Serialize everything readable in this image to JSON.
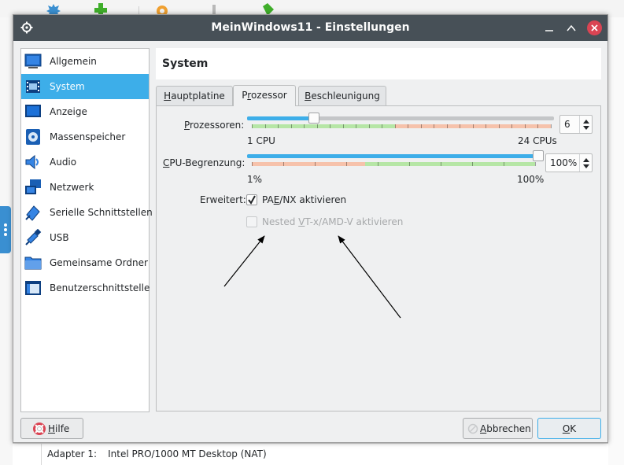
{
  "background": {
    "adapter_label": "Adapter 1:",
    "adapter_value": "Intel PRO/1000 MT Desktop (NAT)"
  },
  "dialog": {
    "title": "MeinWindows11 - Einstellungen"
  },
  "sidebar": {
    "items": [
      {
        "label": "Allgemein",
        "icon": "general-icon"
      },
      {
        "label": "System",
        "icon": "system-chip-icon",
        "selected": true
      },
      {
        "label": "Anzeige",
        "icon": "display-monitor-icon"
      },
      {
        "label": "Massenspeicher",
        "icon": "storage-disk-icon"
      },
      {
        "label": "Audio",
        "icon": "audio-speaker-icon"
      },
      {
        "label": "Netzwerk",
        "icon": "network-icon"
      },
      {
        "label": "Serielle Schnittstellen",
        "icon": "serial-port-icon"
      },
      {
        "label": "USB",
        "icon": "usb-icon"
      },
      {
        "label": "Gemeinsame Ordner",
        "icon": "shared-folder-icon"
      },
      {
        "label": "Benutzerschnittstelle",
        "icon": "user-interface-icon"
      }
    ]
  },
  "main": {
    "header_title": "System",
    "tabs": {
      "hauptplatine": {
        "pre": "",
        "key": "H",
        "post": "auptplatine"
      },
      "prozessor": {
        "pre": "P",
        "key": "r",
        "post": "ozessor",
        "active": true
      },
      "beschleunigung": {
        "pre": "",
        "key": "B",
        "post": "eschleunigung"
      }
    }
  },
  "processor": {
    "label": {
      "pre": "",
      "key": "P",
      "post": "rozessoren:"
    },
    "value": "6",
    "value_number": 6,
    "min": 1,
    "max": 24,
    "min_label": "1 CPU",
    "max_label": "24 CPUs"
  },
  "cpu_limit": {
    "label": {
      "pre": "",
      "key": "C",
      "post": "PU-Begrenzung:"
    },
    "value": "100%",
    "value_number": 100,
    "min": 1,
    "max": 100,
    "min_label": "1%",
    "max_label": "100%"
  },
  "extended": {
    "label": "Erweitert:",
    "pae": {
      "pre": "PA",
      "key": "E",
      "post": "/NX aktivieren",
      "checked": true
    },
    "nested": {
      "pre": "Nested ",
      "key": "V",
      "post": "T-x/AMD-V aktivieren",
      "checked": false,
      "disabled": true
    }
  },
  "buttons": {
    "help": {
      "pre": "",
      "key": "H",
      "post": "ilfe"
    },
    "cancel": {
      "pre": "",
      "key": "A",
      "post": "bbrechen"
    },
    "ok": {
      "pre": "",
      "key": "O",
      "post": "K"
    }
  },
  "colors": {
    "accent": "#3daee9",
    "titlebar": "#475057",
    "close": "#da4453",
    "zone_green": "#b6e6a6",
    "zone_red": "#f6c2ab"
  }
}
